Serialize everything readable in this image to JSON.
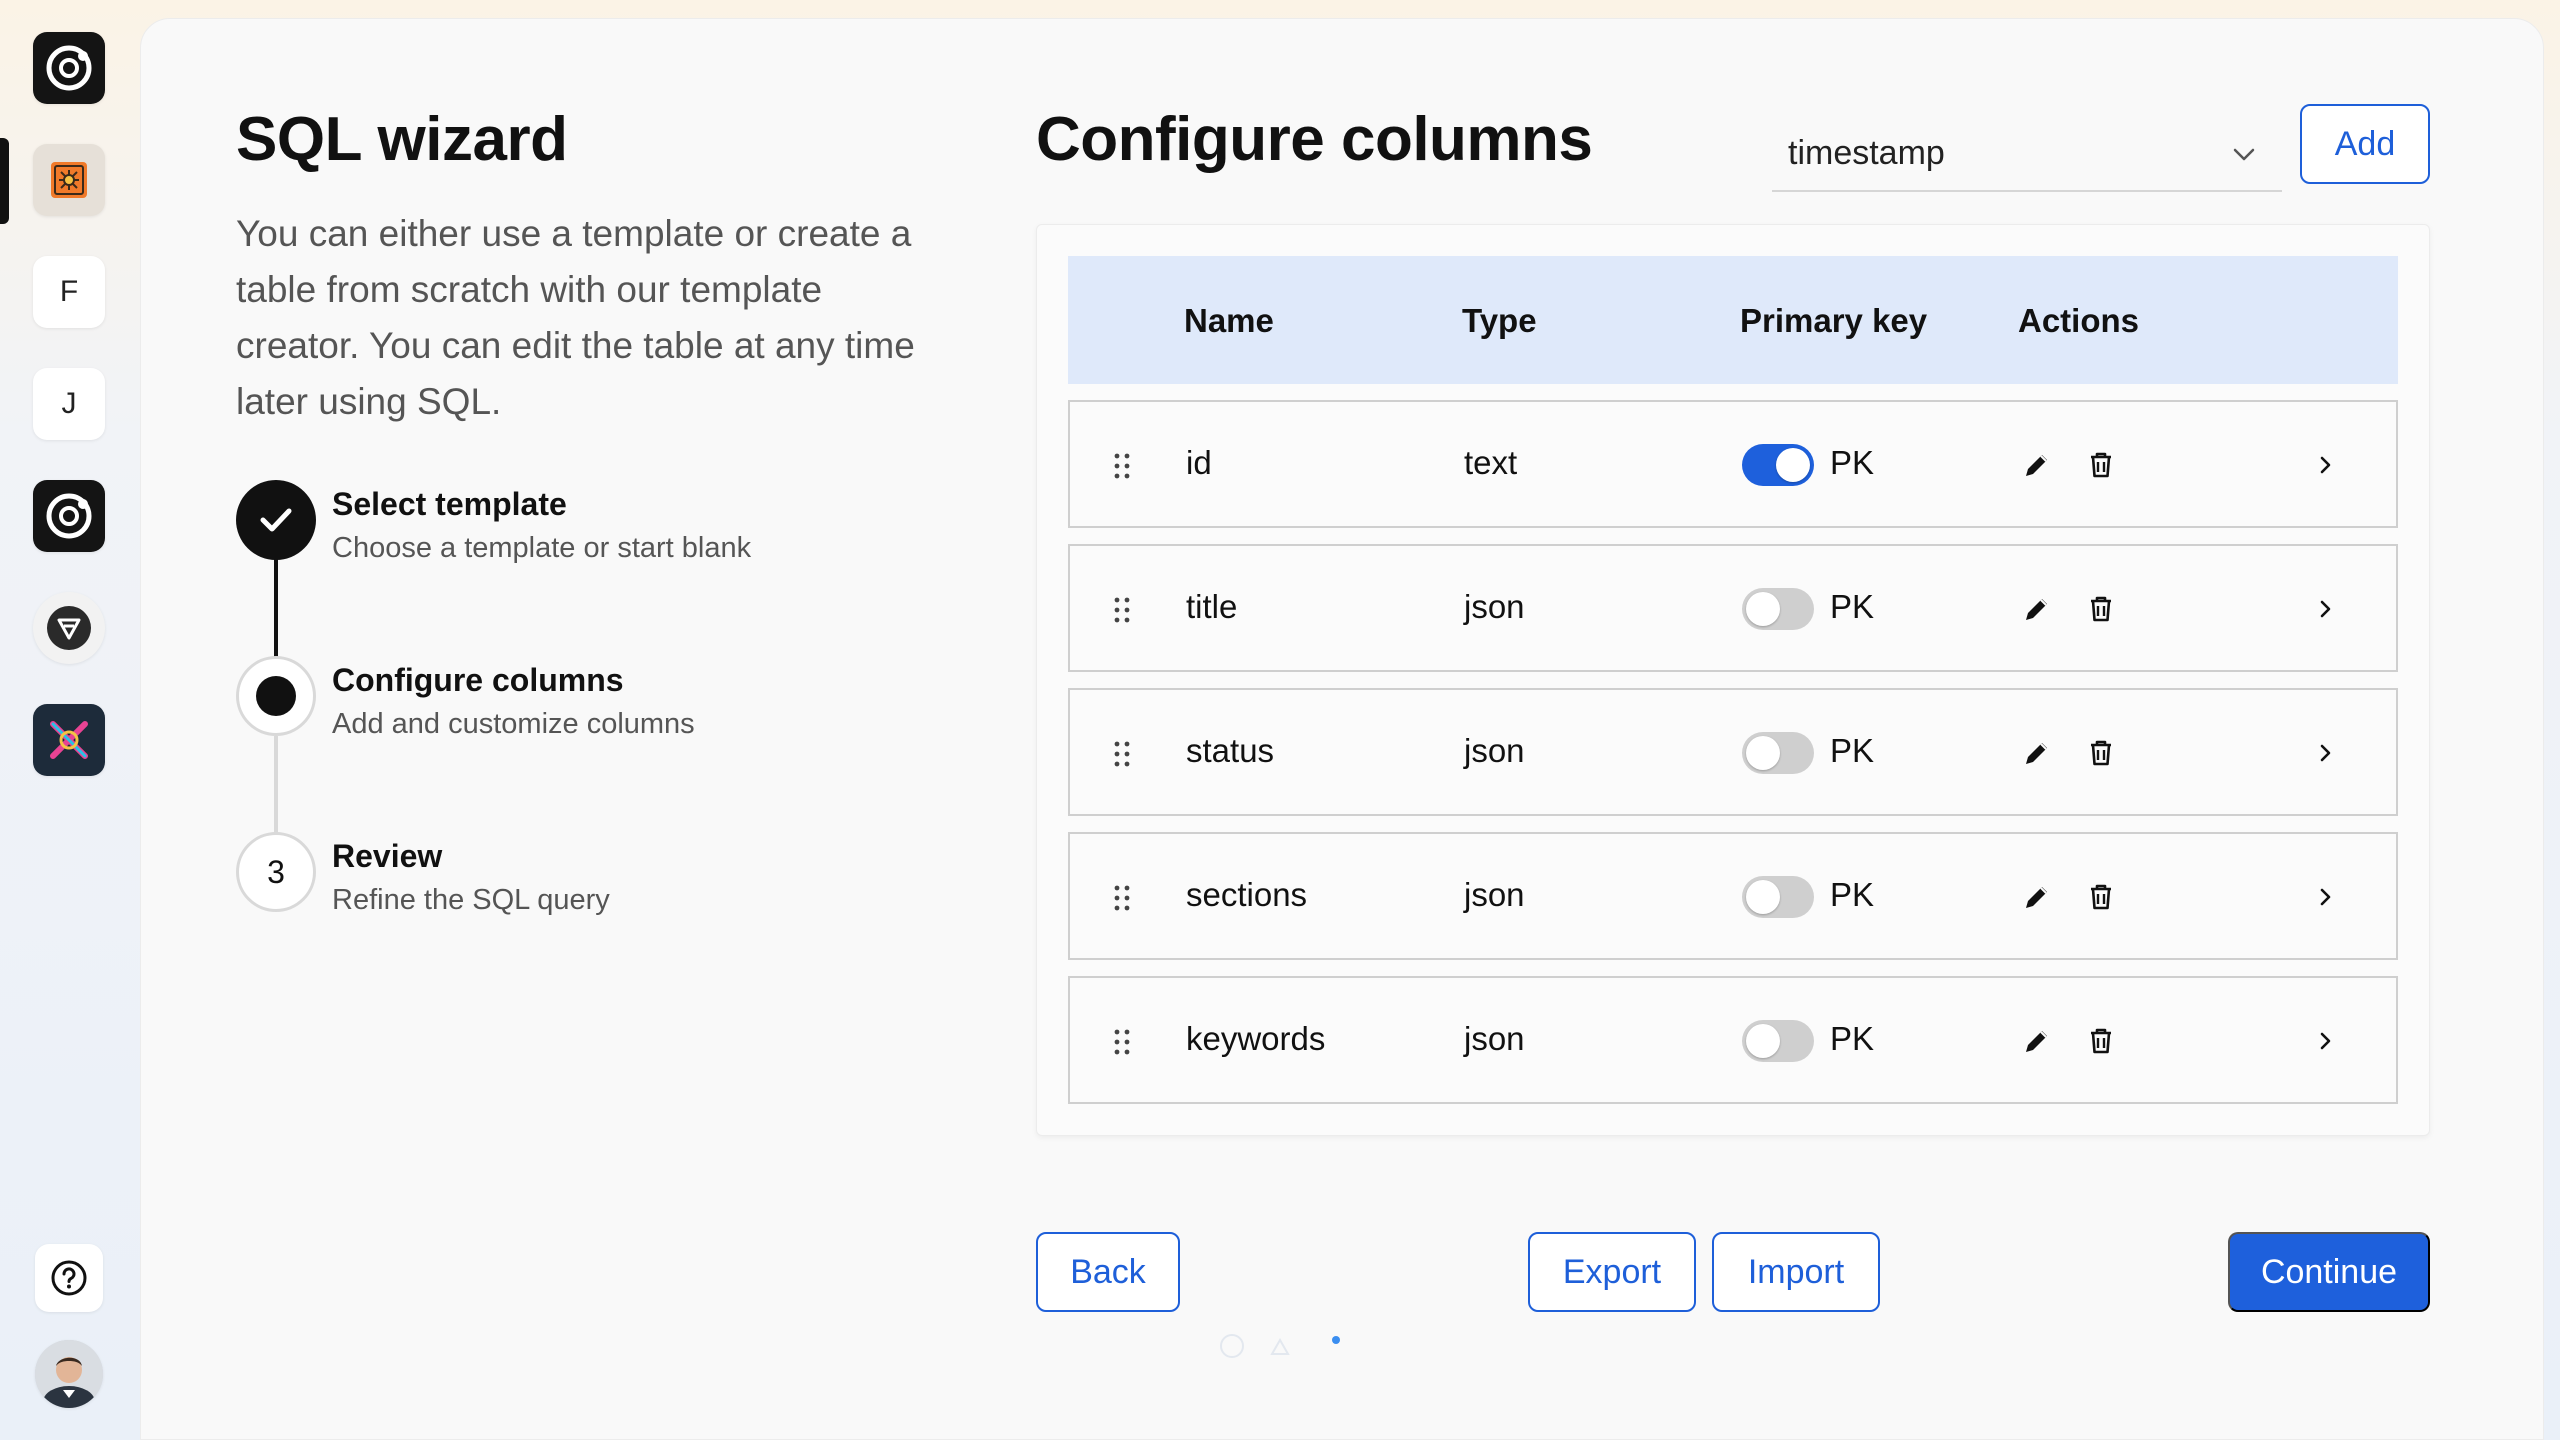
{
  "rail": {
    "items": [
      {
        "name": "app-logo-icon",
        "kind": "logo"
      },
      {
        "name": "project-icon",
        "kind": "image"
      },
      {
        "name": "workspace-f",
        "letter": "F"
      },
      {
        "name": "workspace-j",
        "letter": "J"
      },
      {
        "name": "app-logo-2-icon",
        "kind": "logo"
      },
      {
        "name": "triangle-badge-icon",
        "kind": "badge"
      },
      {
        "name": "tools-icon",
        "kind": "image"
      }
    ],
    "help_icon": "help-icon",
    "avatar": "user-avatar"
  },
  "wizard": {
    "title": "SQL wizard",
    "description": "You can either use a template or create a table from scratch with our template creator. You can edit the table at any time later using SQL.",
    "steps": [
      {
        "title": "Select template",
        "subtitle": "Choose a template or start blank",
        "state": "done"
      },
      {
        "title": "Configure columns",
        "subtitle": "Add and customize columns",
        "state": "current"
      },
      {
        "number": "3",
        "title": "Review",
        "subtitle": "Refine the SQL query",
        "state": "pending"
      }
    ]
  },
  "columns": {
    "heading": "Configure columns",
    "type_select": {
      "value": "timestamp"
    },
    "add_label": "Add",
    "table": {
      "headers": [
        "Name",
        "Type",
        "Primary key",
        "Actions"
      ],
      "rows": [
        {
          "name": "id",
          "type": "text",
          "pk": "PK",
          "pk_on": true
        },
        {
          "name": "title",
          "type": "json",
          "pk": "PK",
          "pk_on": false
        },
        {
          "name": "status",
          "type": "json",
          "pk": "PK",
          "pk_on": false
        },
        {
          "name": "sections",
          "type": "json",
          "pk": "PK",
          "pk_on": false
        },
        {
          "name": "keywords",
          "type": "json",
          "pk": "PK",
          "pk_on": false
        }
      ]
    },
    "buttons": {
      "back": "Back",
      "export": "Export",
      "import": "Import",
      "continue": "Continue"
    }
  },
  "colors": {
    "accent": "#1e60dc",
    "header_bg": "#dfe9fa",
    "text": "#111111"
  }
}
